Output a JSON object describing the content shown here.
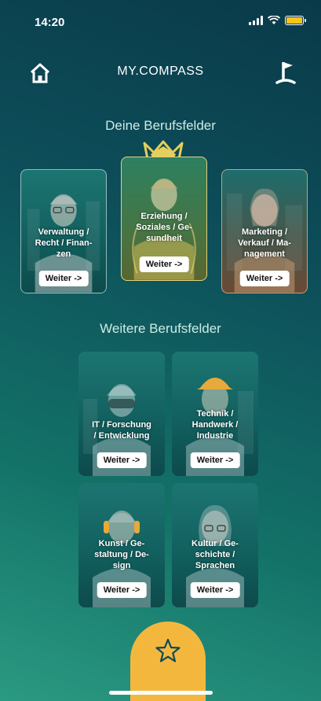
{
  "status_bar": {
    "time": "14:20",
    "battery_color": "#f5c518"
  },
  "nav": {
    "title": "MY.COMPASS",
    "home_icon": "home-icon",
    "flag_icon": "flag-icon"
  },
  "sections": {
    "primary_title": "Deine Berufsfelder",
    "secondary_title": "Weitere Berufsfelder"
  },
  "primary_cards": [
    {
      "label_lines": [
        "Verwaltung /",
        "Recht / Finan-",
        "zen"
      ],
      "button": "Weiter ->"
    },
    {
      "label_lines": [
        "Erziehung /",
        "Soziales / Ge-",
        "sundheit"
      ],
      "button": "Weiter ->"
    },
    {
      "label_lines": [
        "Marketing /",
        "Verkauf / Ma-",
        "nagement"
      ],
      "button": "Weiter ->"
    }
  ],
  "secondary_cards": [
    {
      "label_lines": [
        "IT / Forschung",
        "/ Entwicklung"
      ],
      "button": "Weiter ->"
    },
    {
      "label_lines": [
        "Technik /",
        "Handwerk /",
        "Industrie"
      ],
      "button": "Weiter ->"
    },
    {
      "label_lines": [
        "Kunst / Ge-",
        "staltung / De-",
        "sign"
      ],
      "button": "Weiter ->"
    },
    {
      "label_lines": [
        "Kultur / Ge-",
        "schichte /",
        "Sprachen"
      ],
      "button": "Weiter ->"
    }
  ],
  "fab": {
    "icon": "star-icon"
  },
  "colors": {
    "accent": "#f4b73e",
    "featured_border": "#e3d27c"
  }
}
